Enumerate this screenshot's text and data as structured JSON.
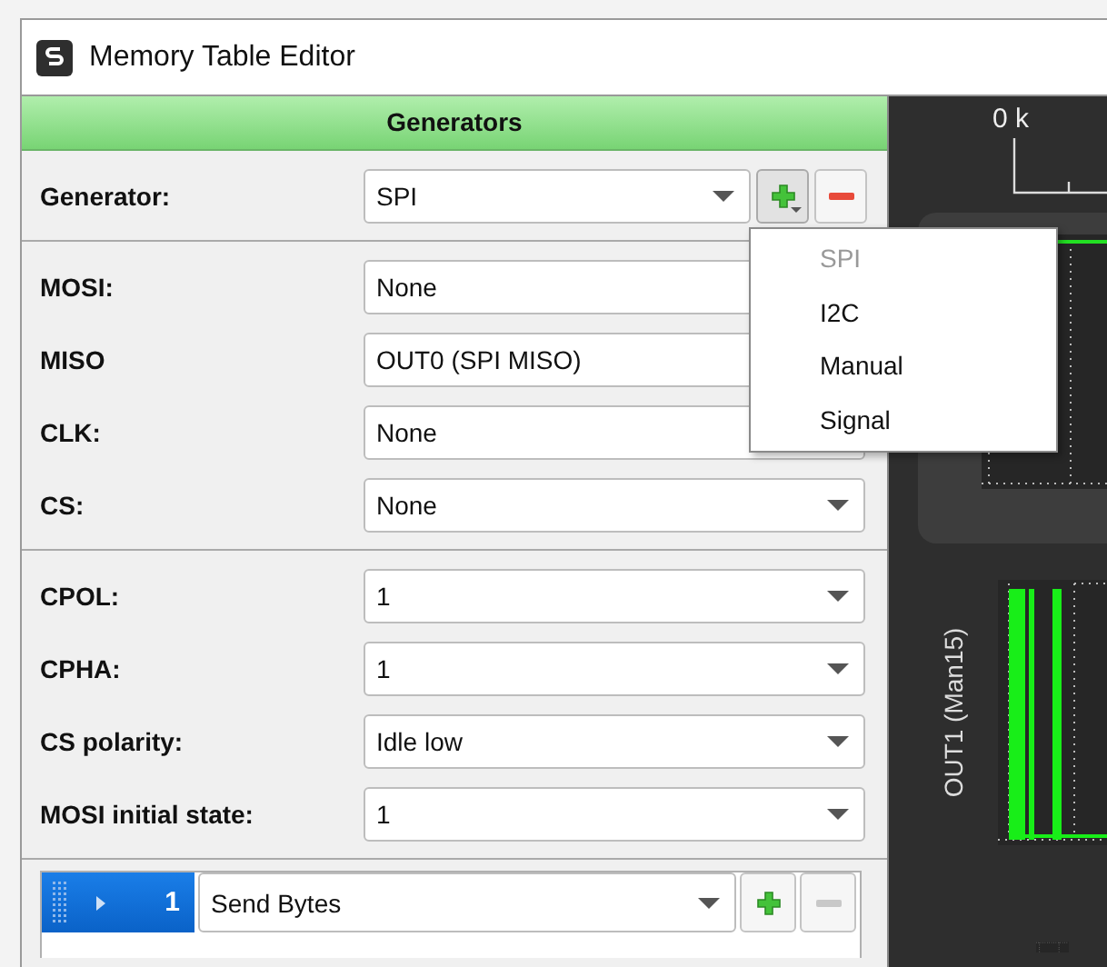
{
  "window": {
    "title": "Memory Table Editor"
  },
  "panel": {
    "title": "Generators"
  },
  "generator": {
    "label": "Generator:",
    "value": "SPI",
    "remove_disabled": false
  },
  "menu": {
    "items": [
      {
        "label": "SPI",
        "disabled": true
      },
      {
        "label": "I2C",
        "disabled": false
      },
      {
        "label": "Manual",
        "disabled": false
      },
      {
        "label": "Signal",
        "disabled": false
      }
    ]
  },
  "groups": [
    [
      {
        "label": "MOSI:",
        "value": "None"
      },
      {
        "label": "MISO",
        "value": "OUT0 (SPI MISO)"
      },
      {
        "label": "CLK:",
        "value": "None"
      },
      {
        "label": "CS:",
        "value": "None"
      }
    ],
    [
      {
        "label": "CPOL:",
        "value": "1"
      },
      {
        "label": "CPHA:",
        "value": "1"
      },
      {
        "label": "CS polarity:",
        "value": "Idle low"
      },
      {
        "label": "MOSI initial state:",
        "value": "1"
      }
    ]
  ],
  "sequence": [
    {
      "index": "1",
      "value": "Send Bytes",
      "selected": true,
      "expanded": false,
      "remove_disabled": true
    }
  ],
  "plot": {
    "axis_label": "0 k",
    "channel_label": "OUT1 (Man15)"
  }
}
